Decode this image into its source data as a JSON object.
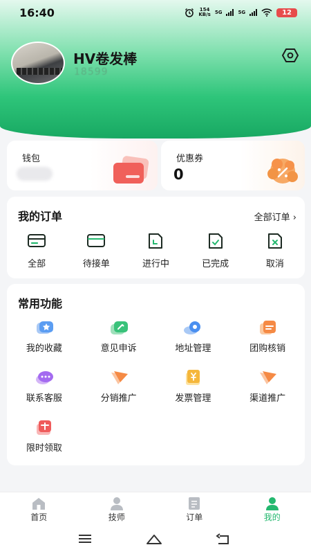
{
  "status_bar": {
    "time": "16:40",
    "net_speed": "154",
    "net_unit": "KB/s",
    "sig1": "5G",
    "sig2": "5G",
    "battery": "12"
  },
  "profile": {
    "name": "HV卷发棒",
    "phone": "18599            "
  },
  "wallet": {
    "label": "钱包",
    "value": ""
  },
  "coupon": {
    "label": "优惠券",
    "value": "0"
  },
  "orders": {
    "title": "我的订单",
    "all_label": "全部订单 ›",
    "items": [
      {
        "label": "全部",
        "icon": "card-icon"
      },
      {
        "label": "待接单",
        "icon": "card-outline-icon"
      },
      {
        "label": "进行中",
        "icon": "document-progress-icon"
      },
      {
        "label": "已完成",
        "icon": "document-check-icon"
      },
      {
        "label": "取消",
        "icon": "document-cancel-icon"
      }
    ]
  },
  "features": {
    "title": "常用功能",
    "items": [
      {
        "label": "我的收藏",
        "icon": "favorite-icon"
      },
      {
        "label": "意见申诉",
        "icon": "feedback-icon"
      },
      {
        "label": "地址管理",
        "icon": "address-icon"
      },
      {
        "label": "团购核销",
        "icon": "group-buy-icon"
      },
      {
        "label": "联系客服",
        "icon": "customer-service-icon"
      },
      {
        "label": "分销推广",
        "icon": "distribution-icon"
      },
      {
        "label": "发票管理",
        "icon": "invoice-icon"
      },
      {
        "label": "渠道推广",
        "icon": "channel-icon"
      },
      {
        "label": "限时领取",
        "icon": "limited-gift-icon"
      }
    ]
  },
  "tabbar": {
    "items": [
      {
        "label": "首页",
        "icon": "home-icon"
      },
      {
        "label": "技师",
        "icon": "technician-icon"
      },
      {
        "label": "订单",
        "icon": "order-icon"
      },
      {
        "label": "我的",
        "icon": "profile-icon"
      }
    ]
  },
  "colors": {
    "brand_green": "#24b86f",
    "header_top": "#e4f8ee",
    "header_bottom": "#18a862",
    "order_icon": "#1c2a22"
  }
}
